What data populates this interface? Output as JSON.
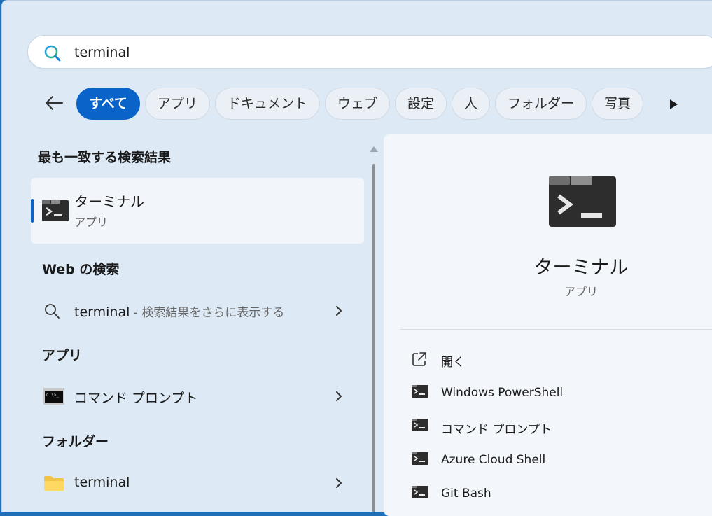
{
  "search": {
    "query": "terminal"
  },
  "filters": [
    "すべて",
    "アプリ",
    "ドキュメント",
    "ウェブ",
    "設定",
    "人",
    "フォルダー",
    "写真"
  ],
  "sections": {
    "best_match_title": "最も一致する検索結果",
    "web_title": "Web の検索",
    "apps_title": "アプリ",
    "folders_title": "フォルダー"
  },
  "best_match": {
    "name": "ターミナル",
    "type": "アプリ"
  },
  "web_result": {
    "query": "terminal",
    "hint": " - 検索結果をさらに表示する"
  },
  "app_result": {
    "name": "コマンド プロンプト"
  },
  "folder_result": {
    "name": "terminal"
  },
  "detail": {
    "name": "ターミナル",
    "type": "アプリ",
    "actions": [
      "開く",
      "Windows PowerShell",
      "コマンド プロンプト",
      "Azure Cloud Shell",
      "Git Bash"
    ]
  },
  "colors": {
    "accent": "#0a63c8",
    "panel": "#dde9f5"
  }
}
